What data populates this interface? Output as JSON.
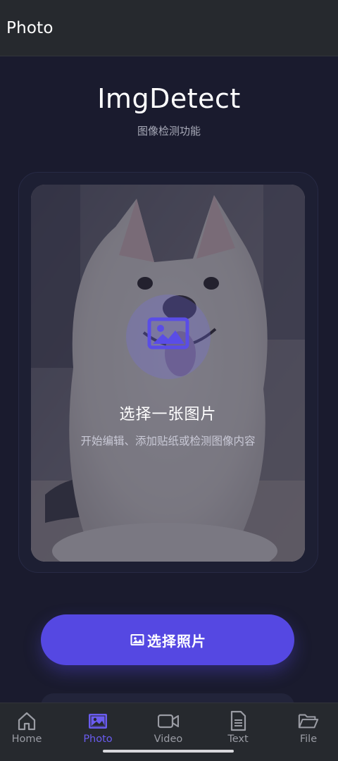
{
  "app_bar": {
    "title": "Photo"
  },
  "hero": {
    "title": "ImgDetect",
    "subtitle": "图像检测功能"
  },
  "picker_card": {
    "title": "选择一张图片",
    "subtitle": "开始编辑、添加贴纸或检测图像内容",
    "icon": "image-icon",
    "background": "samoyed-dog-photo"
  },
  "primary_action": {
    "label": "选择照片",
    "icon": "image-icon"
  },
  "bottom_nav": {
    "items": [
      {
        "label": "Home",
        "icon": "home-icon",
        "active": false
      },
      {
        "label": "Photo",
        "icon": "image-icon",
        "active": true
      },
      {
        "label": "Video",
        "icon": "video-camera-icon",
        "active": false
      },
      {
        "label": "Text",
        "icon": "document-icon",
        "active": false
      },
      {
        "label": "File",
        "icon": "folder-icon",
        "active": false
      }
    ]
  },
  "colors": {
    "background": "#1a1b2e",
    "bar": "#26292e",
    "accent": "#5548e2",
    "active_nav": "#6a5cf0",
    "inactive_nav": "#9a9ca4"
  }
}
